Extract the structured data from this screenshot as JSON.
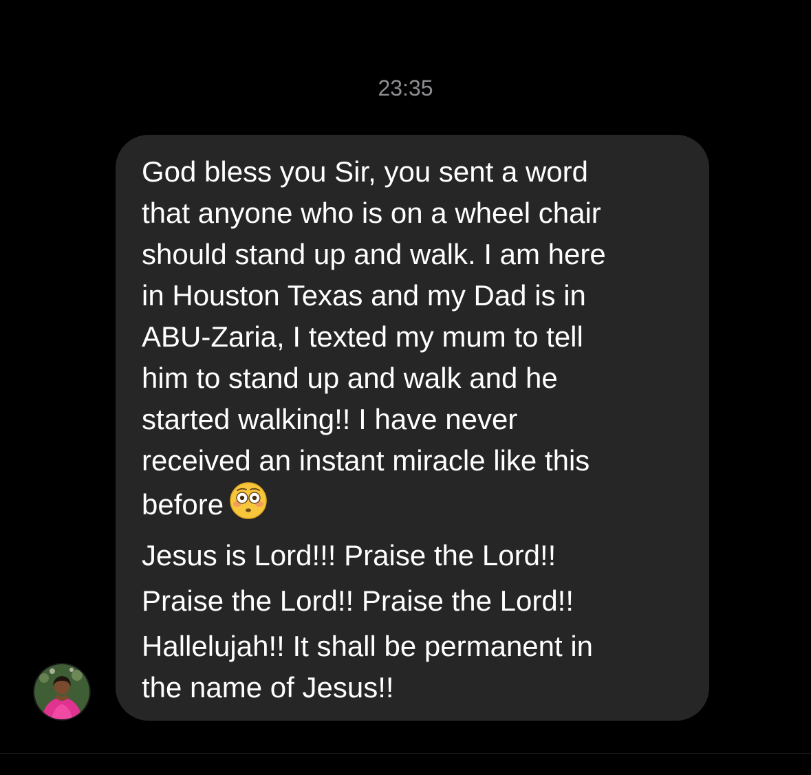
{
  "timestamp": "23:35",
  "message": {
    "lines": [
      "God bless you Sir, you sent a word",
      "that anyone who is on a wheel chair",
      "should stand up and walk. I am here",
      "in Houston Texas and my Dad is in",
      "ABU-Zaria, I texted my mum to tell",
      "him to stand up and walk and he",
      "started walking!! I have never",
      "received an instant miracle like this",
      "before",
      "Jesus is Lord!!! Praise the Lord!!",
      "Praise the Lord!! Praise the Lord!!",
      "Hallelujah!! It shall be permanent in",
      "the name of Jesus!!"
    ],
    "emoji": "flushed-face-emoji"
  },
  "avatar": "profile-photo",
  "colors": {
    "background": "#000000",
    "bubble": "#262626",
    "text": "#ffffff",
    "timestamp": "#8e8e93"
  }
}
